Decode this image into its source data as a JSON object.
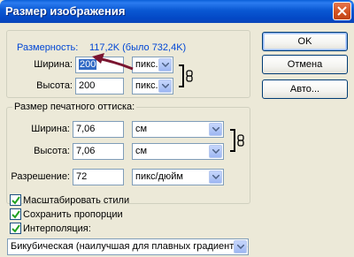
{
  "window": {
    "title": "Размер изображения"
  },
  "dimensions": {
    "label": "Размерность:",
    "value": "117,2K (было 732,4K)"
  },
  "pixel": {
    "width": {
      "label": "Ширина:",
      "value": "200",
      "unit": "пикс."
    },
    "height": {
      "label": "Высота:",
      "value": "200",
      "unit": "пикс."
    }
  },
  "print": {
    "legend": "Размер печатного оттиска:",
    "width": {
      "label": "Ширина:",
      "value": "7,06",
      "unit": "см"
    },
    "height": {
      "label": "Высота:",
      "value": "7,06",
      "unit": "см"
    },
    "resolution": {
      "label": "Разрешение:",
      "value": "72",
      "unit": "пикс/дюйм"
    }
  },
  "options": {
    "scale_styles": {
      "label": "Масштабировать стили",
      "checked": true
    },
    "constrain": {
      "label": "Сохранить пропорции",
      "checked": true
    },
    "resample": {
      "label": "Интерполяция:",
      "checked": true
    }
  },
  "interpolation": {
    "value": "Бикубическая (наилучшая для плавных градиентов)"
  },
  "buttons": {
    "ok": "OK",
    "cancel": "Отмена",
    "auto": "Авто..."
  },
  "colors": {
    "accent": "#0046d5",
    "annotation": "#7a1530",
    "titlebar": "#0a58d3"
  }
}
